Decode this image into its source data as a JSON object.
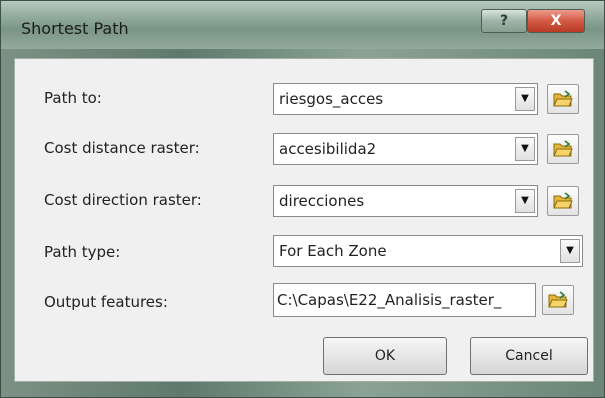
{
  "window": {
    "title": "Shortest Path",
    "help_label": "?",
    "close_label": "X"
  },
  "form": {
    "path_to": {
      "label": "Path to:",
      "value": "riesgos_acces"
    },
    "cost_distance": {
      "label": "Cost distance raster:",
      "value": "accesibilida2"
    },
    "cost_direction": {
      "label": "Cost direction raster:",
      "value": "direcciones"
    },
    "path_type": {
      "label": "Path type:",
      "value": "For Each Zone"
    },
    "output_features": {
      "label": "Output features:",
      "value": "C:\\Capas\\E22_Analisis_raster_"
    }
  },
  "buttons": {
    "ok": "OK",
    "cancel": "Cancel"
  },
  "icons": {
    "dropdown": "chevron-down-icon",
    "browse": "open-folder-icon"
  },
  "colors": {
    "close_button": "#d35a44",
    "dialog_background": "#f0f0f0",
    "folder_icon": "#e6b63b"
  }
}
